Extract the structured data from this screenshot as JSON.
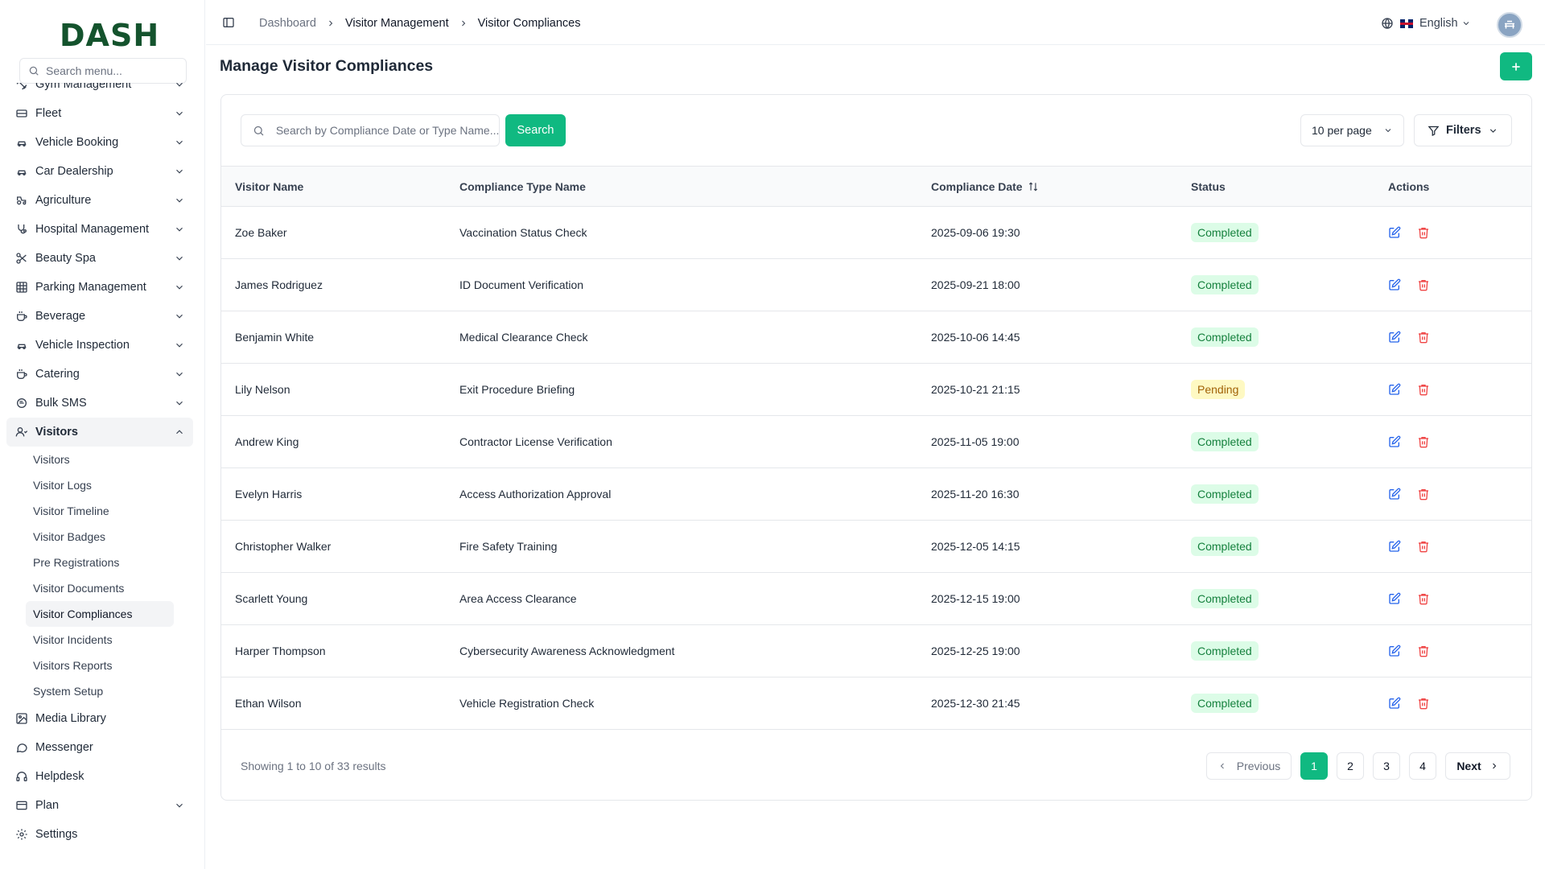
{
  "brand": {
    "logo_text": "DASH"
  },
  "sidebar": {
    "search_placeholder": "Search menu...",
    "partial_item": {
      "label": "Gym Management"
    },
    "items": [
      {
        "label": "Fleet",
        "icon": "fleet-icon"
      },
      {
        "label": "Vehicle Booking",
        "icon": "car-icon"
      },
      {
        "label": "Car Dealership",
        "icon": "car-icon"
      },
      {
        "label": "Agriculture",
        "icon": "tractor-icon"
      },
      {
        "label": "Hospital Management",
        "icon": "stethoscope-icon"
      },
      {
        "label": "Beauty Spa",
        "icon": "scissors-icon"
      },
      {
        "label": "Parking Management",
        "icon": "grid-icon"
      },
      {
        "label": "Beverage",
        "icon": "cup-icon"
      },
      {
        "label": "Vehicle Inspection",
        "icon": "car-icon"
      },
      {
        "label": "Catering",
        "icon": "cup-icon"
      },
      {
        "label": "Bulk SMS",
        "icon": "message-icon"
      }
    ],
    "visitors": {
      "label": "Visitors",
      "sub": [
        "Visitors",
        "Visitor Logs",
        "Visitor Timeline",
        "Visitor Badges",
        "Pre Registrations",
        "Visitor Documents",
        "Visitor Compliances",
        "Visitor Incidents",
        "Visitors Reports",
        "System Setup"
      ],
      "active_index": 6
    },
    "bottom": [
      {
        "label": "Media Library",
        "icon": "image-icon",
        "chevron": false
      },
      {
        "label": "Messenger",
        "icon": "chat-icon",
        "chevron": false
      },
      {
        "label": "Helpdesk",
        "icon": "headset-icon",
        "chevron": false
      },
      {
        "label": "Plan",
        "icon": "card-icon",
        "chevron": true
      },
      {
        "label": "Settings",
        "icon": "gear-icon",
        "chevron": false
      }
    ]
  },
  "header": {
    "breadcrumb": [
      "Dashboard",
      "Visitor Management",
      "Visitor Compliances"
    ],
    "language": "English"
  },
  "main": {
    "title": "Manage Visitor Compliances",
    "search_placeholder": "Search by Compliance Date or Type Name...",
    "search_label": "Search",
    "per_page": "10 per page",
    "filters_label": "Filters",
    "columns": [
      "Visitor Name",
      "Compliance Type Name",
      "Compliance Date",
      "Status",
      "Actions"
    ],
    "rows": [
      {
        "name": "Zoe Baker",
        "type": "Vaccination Status Check",
        "date": "2025-09-06 19:30",
        "status": "Completed"
      },
      {
        "name": "James Rodriguez",
        "type": "ID Document Verification",
        "date": "2025-09-21 18:00",
        "status": "Completed"
      },
      {
        "name": "Benjamin White",
        "type": "Medical Clearance Check",
        "date": "2025-10-06 14:45",
        "status": "Completed"
      },
      {
        "name": "Lily Nelson",
        "type": "Exit Procedure Briefing",
        "date": "2025-10-21 21:15",
        "status": "Pending"
      },
      {
        "name": "Andrew King",
        "type": "Contractor License Verification",
        "date": "2025-11-05 19:00",
        "status": "Completed"
      },
      {
        "name": "Evelyn Harris",
        "type": "Access Authorization Approval",
        "date": "2025-11-20 16:30",
        "status": "Completed"
      },
      {
        "name": "Christopher Walker",
        "type": "Fire Safety Training",
        "date": "2025-12-05 14:15",
        "status": "Completed"
      },
      {
        "name": "Scarlett Young",
        "type": "Area Access Clearance",
        "date": "2025-12-15 19:00",
        "status": "Completed"
      },
      {
        "name": "Harper Thompson",
        "type": "Cybersecurity Awareness Acknowledgment",
        "date": "2025-12-25 19:00",
        "status": "Completed"
      },
      {
        "name": "Ethan Wilson",
        "type": "Vehicle Registration Check",
        "date": "2025-12-30 21:45",
        "status": "Completed"
      }
    ],
    "showing": "Showing 1 to 10 of 33 results",
    "pagination": {
      "prev": "Previous",
      "next": "Next",
      "pages": [
        "1",
        "2",
        "3",
        "4"
      ],
      "active": "1"
    }
  },
  "colors": {
    "accent": "#10b981",
    "completed_bg": "#dcfce7",
    "completed_fg": "#15803d",
    "pending_bg": "#fef9c3",
    "pending_fg": "#a16207",
    "edit": "#2563eb",
    "delete": "#ef4444"
  }
}
